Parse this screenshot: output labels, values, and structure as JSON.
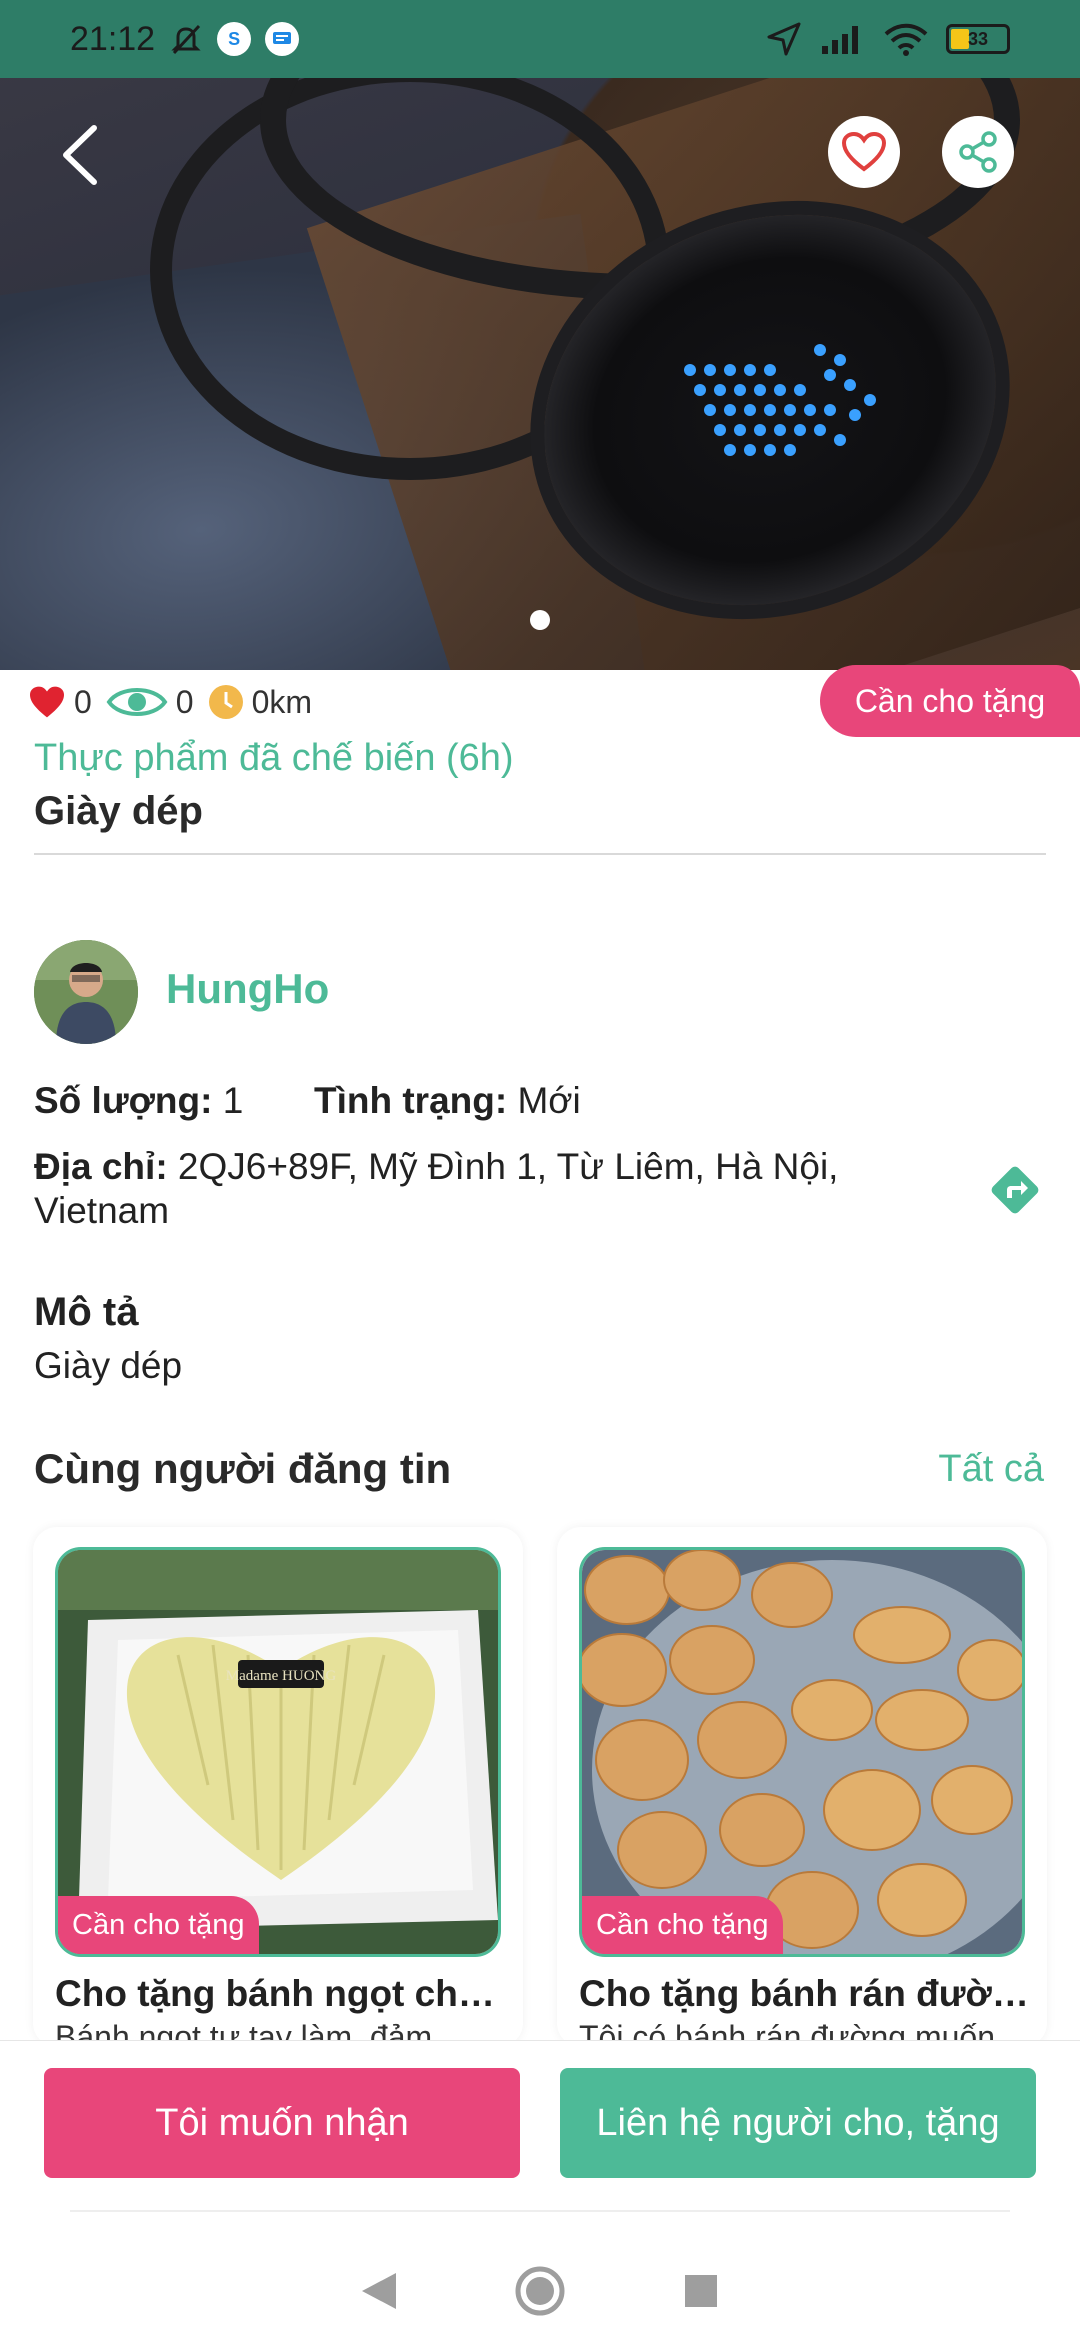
{
  "status_bar": {
    "time": "21:12",
    "battery": "33",
    "icons": [
      "mute-bell-icon",
      "skype-icon",
      "message-icon",
      "location-arrow-icon",
      "signal-icon",
      "wifi-icon",
      "battery-icon"
    ]
  },
  "hero": {
    "image": "headphones-led-photo",
    "page_indicator": "1 of 1"
  },
  "stats": {
    "likes": "0",
    "views": "0",
    "distance": "0km"
  },
  "listing": {
    "badge": "Cần cho tặng",
    "category": "Thực phẩm đã chế biến (6h)",
    "title": "Giày dép"
  },
  "owner": {
    "name": "HungHo"
  },
  "details": {
    "quantity_label": "Số lượng:",
    "quantity_value": "1",
    "condition_label": "Tình trạng:",
    "condition_value": "Mới",
    "address_label": "Địa chỉ:",
    "address_value": "2QJ6+89F, Mỹ Đình 1, Từ Liêm, Hà Nội, Vietnam"
  },
  "description": {
    "heading": "Mô tả",
    "text": "Giày dép"
  },
  "related": {
    "heading": "Cùng người đăng tin",
    "see_all": "Tất cả",
    "items": [
      {
        "badge": "Cần cho tặng",
        "title": "Cho tặng bánh ngọt cho...",
        "desc": "Bánh ngọt tự tay làm, đảm",
        "image": "heart-cake-photo",
        "image_text": "Madame HUONG"
      },
      {
        "badge": "Cần cho tặng",
        "title": "Cho tặng bánh rán đường",
        "desc": "Tôi có bánh rán đường muốn",
        "image": "fried-donuts-photo"
      }
    ]
  },
  "actions": {
    "receive": "Tôi muốn nhận",
    "contact": "Liên hệ người cho, tặng"
  },
  "colors": {
    "green": "#4dba97",
    "pink": "#e8467a",
    "status_bar": "#2e7d67"
  }
}
